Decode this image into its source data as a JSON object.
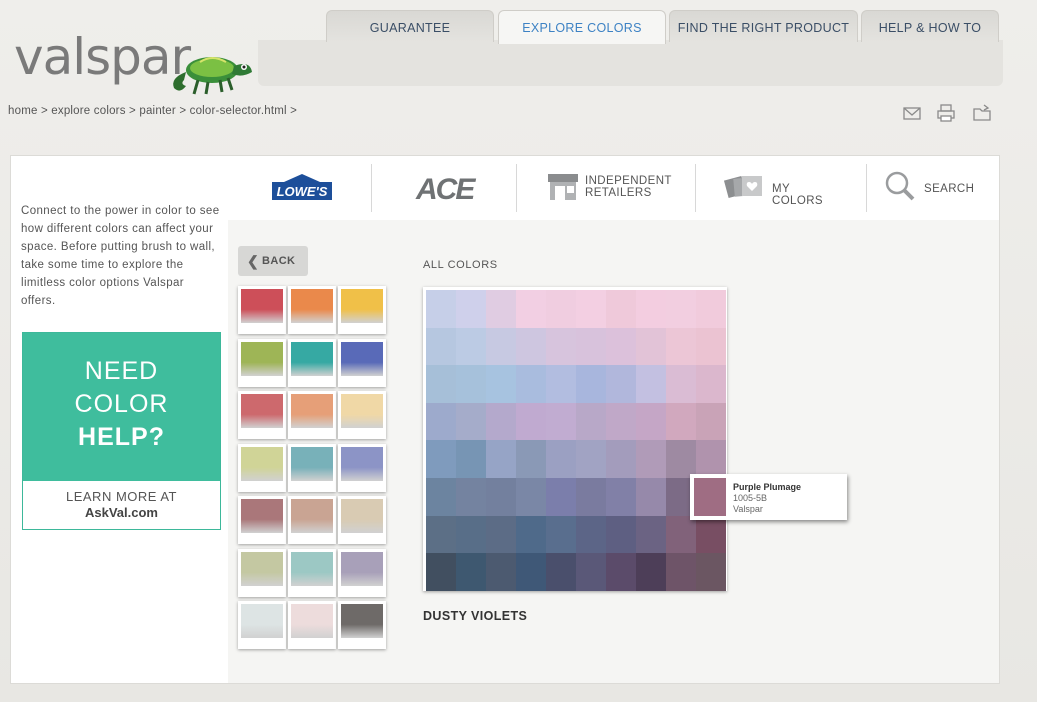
{
  "brand": {
    "logo_text": "valspar"
  },
  "nav": {
    "tabs": [
      {
        "label": "GUARANTEE",
        "active": false
      },
      {
        "label": "EXPLORE COLORS",
        "active": true
      },
      {
        "label": "FIND THE RIGHT PRODUCT",
        "active": false
      },
      {
        "label": "HELP & HOW TO",
        "active": false
      }
    ]
  },
  "breadcrumb": "home > explore colors > painter > color-selector.html >",
  "toolbar_icons": [
    "email-icon",
    "print-icon",
    "save-folder-icon"
  ],
  "intro": "Connect to the power in color to see how different colors can affect your space. Before putting brush to wall, take some time to explore the limitless color options Valspar offers.",
  "promo": {
    "line1": "NEED",
    "line2": "COLOR",
    "line3": "HELP?",
    "learn": "LEARN MORE AT",
    "link": "AskVal.com"
  },
  "retailers": {
    "lowes": "LOWE'S",
    "ace": "ACE",
    "independent_1": "INDEPENDENT",
    "independent_2": "RETAILERS",
    "my_colors": "MY COLORS",
    "search": "SEARCH"
  },
  "back_label": "BACK",
  "all_colors_label": "ALL COLORS",
  "family_name": "DUSTY VIOLETS",
  "tooltip": {
    "name": "Purple Plumage",
    "code": "1005-5B",
    "brand": "Valspar",
    "color": "#9f6d83"
  },
  "families": [
    [
      "#c8505a",
      "#e68a4f",
      "#eec04e"
    ],
    [
      "#9fb45a",
      "#3aa8a2",
      "#5a6ab4"
    ],
    [
      "#c96a6e",
      "#e3a07a",
      "#efd8a8"
    ],
    [
      "#d0d49a",
      "#7ab0b8",
      "#8c94c4"
    ],
    [
      "#a8787a",
      "#c8a494",
      "#d8cbb4"
    ],
    [
      "#c4c8a4",
      "#9ec8c4",
      "#a8a0b8"
    ],
    [
      "#dde4e4",
      "#ecdcdc",
      "#6e6a68"
    ]
  ],
  "color_grid": [
    [
      "#c6cfe8",
      "#cfd0eb",
      "#e0cce2",
      "#f2cfe3",
      "#f0cde0",
      "#f3cfe2",
      "#efc9da",
      "#f3cde0",
      "#f2cee0",
      "#f1cbdc"
    ],
    [
      "#b6c7e0",
      "#bccbe4",
      "#c7c9e2",
      "#cec6e0",
      "#d7c4dd",
      "#d8c2dc",
      "#dcc1db",
      "#e2c3d7",
      "#ecc6d6",
      "#ebc3d2"
    ],
    [
      "#a6bfd8",
      "#a6c1db",
      "#a7c3e0",
      "#a9bcde",
      "#b2bde0",
      "#a8b6dd",
      "#b1b7dc",
      "#c3c0e1",
      "#dabcd4",
      "#dbb7cd"
    ],
    [
      "#9daacc",
      "#a5acca",
      "#b4a9cc",
      "#c0aad0",
      "#c1acd1",
      "#b8a8c8",
      "#c0a8c8",
      "#c5a6c6",
      "#d1a8be",
      "#c9a3b7"
    ],
    [
      "#7f9bbd",
      "#7795b4",
      "#96a4c6",
      "#8a99b6",
      "#9ba0c2",
      "#a1a3c3",
      "#a39cbc",
      "#b09bb8",
      "#9e8aa2",
      "#b093ad"
    ],
    [
      "#6c84a0",
      "#7483a0",
      "#73809e",
      "#7a87a6",
      "#7b7eab",
      "#7a7b9f",
      "#8180a7",
      "#9689aa",
      "#7c6b86",
      "#9f6d83"
    ],
    [
      "#5c6f86",
      "#586e88",
      "#5c6c86",
      "#4f6a8a",
      "#596e8e",
      "#5c6587",
      "#5e5f82",
      "#6b6383",
      "#81627a",
      "#784e63"
    ],
    [
      "#414f60",
      "#3e5870",
      "#4c5a70",
      "#3f5877",
      "#4a4f6c",
      "#5a5878",
      "#5b4b6a",
      "#4d3e58",
      "#6e5468",
      "#6b5662"
    ]
  ]
}
